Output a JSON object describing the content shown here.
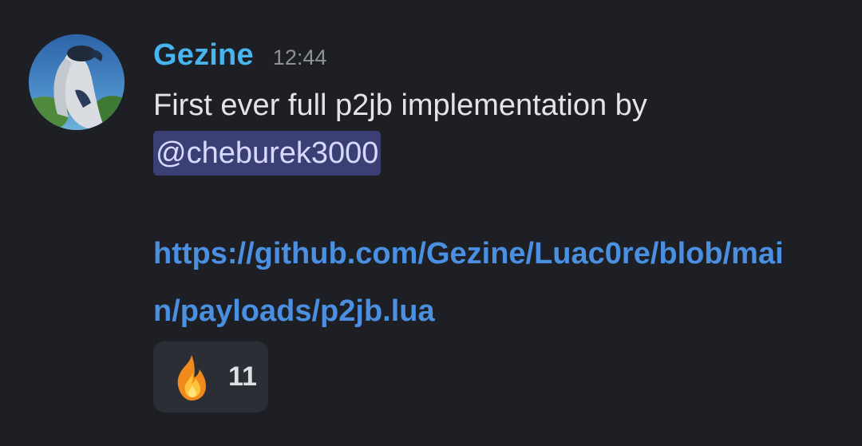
{
  "message": {
    "author": "Gezine",
    "timestamp": "12:44",
    "text": "First ever full p2jb implementation by",
    "mention": "@cheburek3000",
    "link": "https://github.com/Gezine/Luac0re/blob/main/payloads/p2jb.lua",
    "colors": {
      "author": "#48b4f0",
      "link": "#4a8fe0",
      "mention_bg": "#3c3f74",
      "background": "#1e1f24"
    }
  },
  "reactions": [
    {
      "emoji_icon": "fire-icon",
      "count": "11"
    }
  ]
}
